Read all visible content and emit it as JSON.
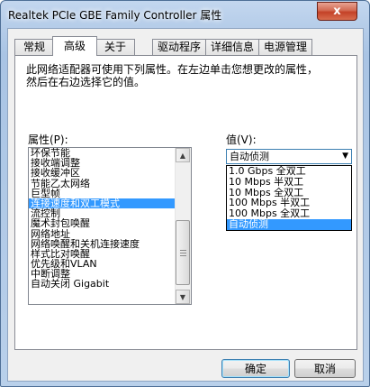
{
  "window": {
    "title": "Realtek PCIe GBE Family Controller 属性",
    "close_label": "x"
  },
  "tabs": [
    {
      "label": "常规"
    },
    {
      "label": "高级"
    },
    {
      "label": "关于"
    },
    {
      "label": "驱动程序"
    },
    {
      "label": "详细信息"
    },
    {
      "label": "电源管理"
    }
  ],
  "active_tab": "高级",
  "description": {
    "line1": "此网络适配器可使用下列属性。在左边单击您想更改的属性，",
    "line2": "然后在右边选择它的值。"
  },
  "property": {
    "label": "属性(P):",
    "items": [
      {
        "label": "环保节能"
      },
      {
        "label": "接收端调整"
      },
      {
        "label": "接收缓冲区"
      },
      {
        "label": "节能乙太网络"
      },
      {
        "label": "巨型帧"
      },
      {
        "label": "连接速度和双工模式"
      },
      {
        "label": "流控制"
      },
      {
        "label": "魔术封包唤醒"
      },
      {
        "label": "网络地址"
      },
      {
        "label": "网络唤醒和关机连接速度"
      },
      {
        "label": "样式比对唤醒"
      },
      {
        "label": "优先级和VLAN"
      },
      {
        "label": "中断调整"
      },
      {
        "label": "自动关闭 Gigabit"
      }
    ],
    "selected": "连接速度和双工模式"
  },
  "value": {
    "label": "值(V):",
    "current": "自动侦测",
    "options": [
      {
        "label": "1.0 Gbps 全双工"
      },
      {
        "label": "10 Mbps 半双工"
      },
      {
        "label": "10 Mbps 全双工"
      },
      {
        "label": "100 Mbps 半双工"
      },
      {
        "label": "100 Mbps 全双工"
      },
      {
        "label": "自动侦测"
      }
    ]
  },
  "buttons": {
    "ok": "确定",
    "cancel": "取消"
  },
  "colors": {
    "selection": "#3399ff",
    "frame": "#b9d0ea",
    "close": "#c44127"
  }
}
